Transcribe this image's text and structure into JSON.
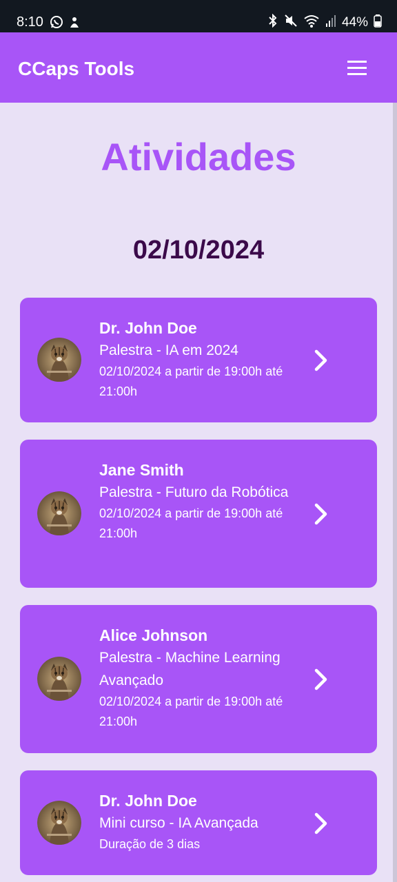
{
  "status_bar": {
    "time": "8:10",
    "battery": "44%",
    "left_icons": [
      "whatsapp-icon",
      "notification-app-icon"
    ],
    "right_icons": [
      "bluetooth-icon",
      "mute-icon",
      "wifi-icon",
      "signal-icon",
      "battery-icon"
    ]
  },
  "app_bar": {
    "title": "CCaps Tools",
    "menu_icon": "hamburger-menu-icon"
  },
  "page": {
    "title": "Atividades",
    "date": "02/10/2024"
  },
  "activities": [
    {
      "speaker": "Dr. John Doe",
      "activity": "Palestra - IA em 2024",
      "schedule": "02/10/2024 a partir de 19:00h até 21:00h",
      "avatar": "cat-avatar"
    },
    {
      "speaker": "Jane Smith",
      "activity": "Palestra - Futuro da Robótica",
      "schedule": "02/10/2024 a partir de 19:00h até 21:00h",
      "avatar": "cat-avatar"
    },
    {
      "speaker": "Alice Johnson",
      "activity": "Palestra - Machine Learning Avançado",
      "schedule": "02/10/2024 a partir de 19:00h até 21:00h",
      "avatar": "cat-avatar"
    },
    {
      "speaker": "Dr. John Doe",
      "activity": "Mini curso - IA Avançada",
      "schedule": "Duração de 3 dias",
      "avatar": "cat-avatar"
    }
  ],
  "colors": {
    "primary": "#A855F7",
    "background": "#E9E1F6",
    "date_text": "#3B0A4A",
    "status_bar": "#121820"
  }
}
